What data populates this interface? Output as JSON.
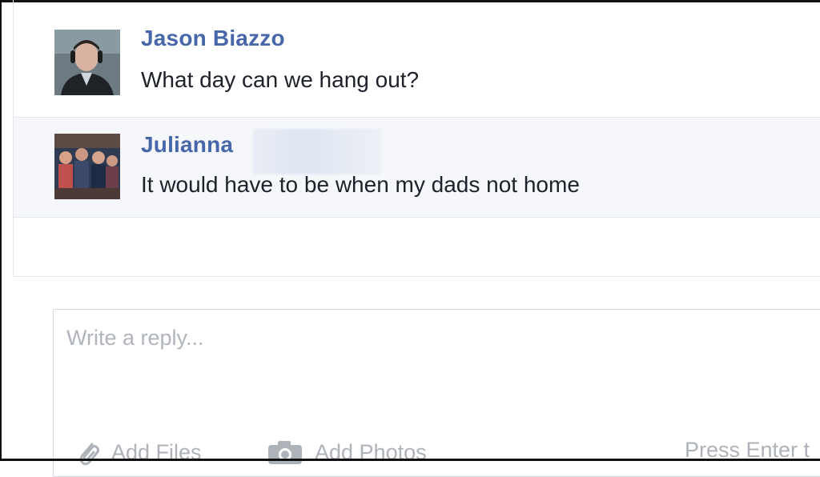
{
  "messages": [
    {
      "sender": "Jason Biazzo",
      "text": "What day can we hang out?",
      "avatar_icon": "profile-photo"
    },
    {
      "sender": "Julianna",
      "text": "It would have to be when my dads not home",
      "avatar_icon": "group-photo"
    }
  ],
  "reply": {
    "placeholder": "Write a reply...",
    "add_files": "Add Files",
    "add_photos": "Add Photos",
    "press_enter": "Press Enter t"
  },
  "colors": {
    "sender_name": "#4867aa",
    "message_text": "#1d2129",
    "highlight_row": "#f5f7fb",
    "placeholder": "#b0b4bb"
  }
}
